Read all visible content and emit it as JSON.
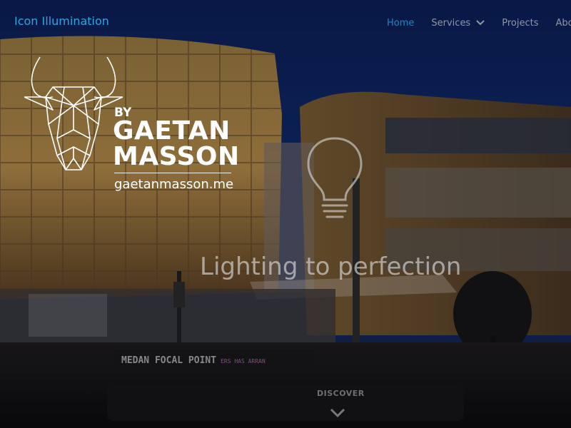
{
  "brand": {
    "name": "Icon Illumination"
  },
  "nav": {
    "items": [
      {
        "label": "Home",
        "active": true
      },
      {
        "label": "Services",
        "has_dropdown": true
      },
      {
        "label": "Projects"
      },
      {
        "label": "About"
      }
    ]
  },
  "watermark": {
    "by": "BY",
    "name_line1": "GAETAN",
    "name_line2": "MASSON",
    "url": "gaetanmasson.me"
  },
  "hero": {
    "tagline": "Lighting to perfection",
    "sign_text": "MEDAN FOCAL POINT",
    "sign_small": "ERS HAS ARRAN",
    "discover_label": "DISCOVER"
  },
  "icons": {
    "logo": "bison-head-icon",
    "bulb": "light-bulb-icon",
    "dropdown": "chevron-down-icon",
    "scroll": "chevron-down-icon"
  },
  "colors": {
    "brand": "#2ea4e2",
    "nav_active": "#1f86c4",
    "nav_text": "#8f97a3",
    "sky": "#0d2a6b"
  }
}
